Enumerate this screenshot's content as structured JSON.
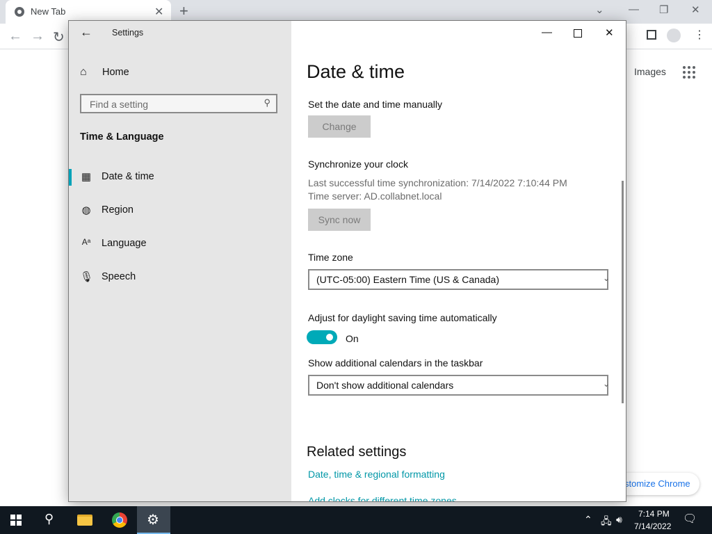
{
  "chrome": {
    "tab_title": "New Tab",
    "tab_close": "✕",
    "new_tab": "+",
    "images_link": "Images",
    "customize_label": "stomize Chrome"
  },
  "settings": {
    "window_title": "Settings",
    "home_label": "Home",
    "search_placeholder": "Find a setting",
    "section_heading": "Time & Language",
    "nav": [
      {
        "label": "Date & time",
        "icon": "calendar-clock-icon",
        "active": true
      },
      {
        "label": "Region",
        "icon": "globe-icon",
        "active": false
      },
      {
        "label": "Language",
        "icon": "language-icon",
        "active": false
      },
      {
        "label": "Speech",
        "icon": "microphone-icon",
        "active": false
      }
    ],
    "page_title": "Date & time",
    "manual_label": "Set the date and time manually",
    "change_button": "Change",
    "sync_heading": "Synchronize your clock",
    "last_sync": "Last successful time synchronization: 7/14/2022 7:10:44 PM",
    "time_server": "Time server: AD.collabnet.local",
    "sync_button": "Sync now",
    "timezone_label": "Time zone",
    "timezone_value": "(UTC-05:00) Eastern Time (US & Canada)",
    "dst_label": "Adjust for daylight saving time automatically",
    "dst_state": "On",
    "calendars_label": "Show additional calendars in the taskbar",
    "calendars_value": "Don't show additional calendars",
    "related_heading": "Related settings",
    "related_link_1": "Date, time & regional formatting",
    "related_link_2": "Add clocks for different time zones"
  },
  "taskbar": {
    "time": "7:14 PM",
    "date": "7/14/2022"
  },
  "colors": {
    "accent": "#00a2b8",
    "link": "#0097a7",
    "taskbar": "#101820"
  }
}
